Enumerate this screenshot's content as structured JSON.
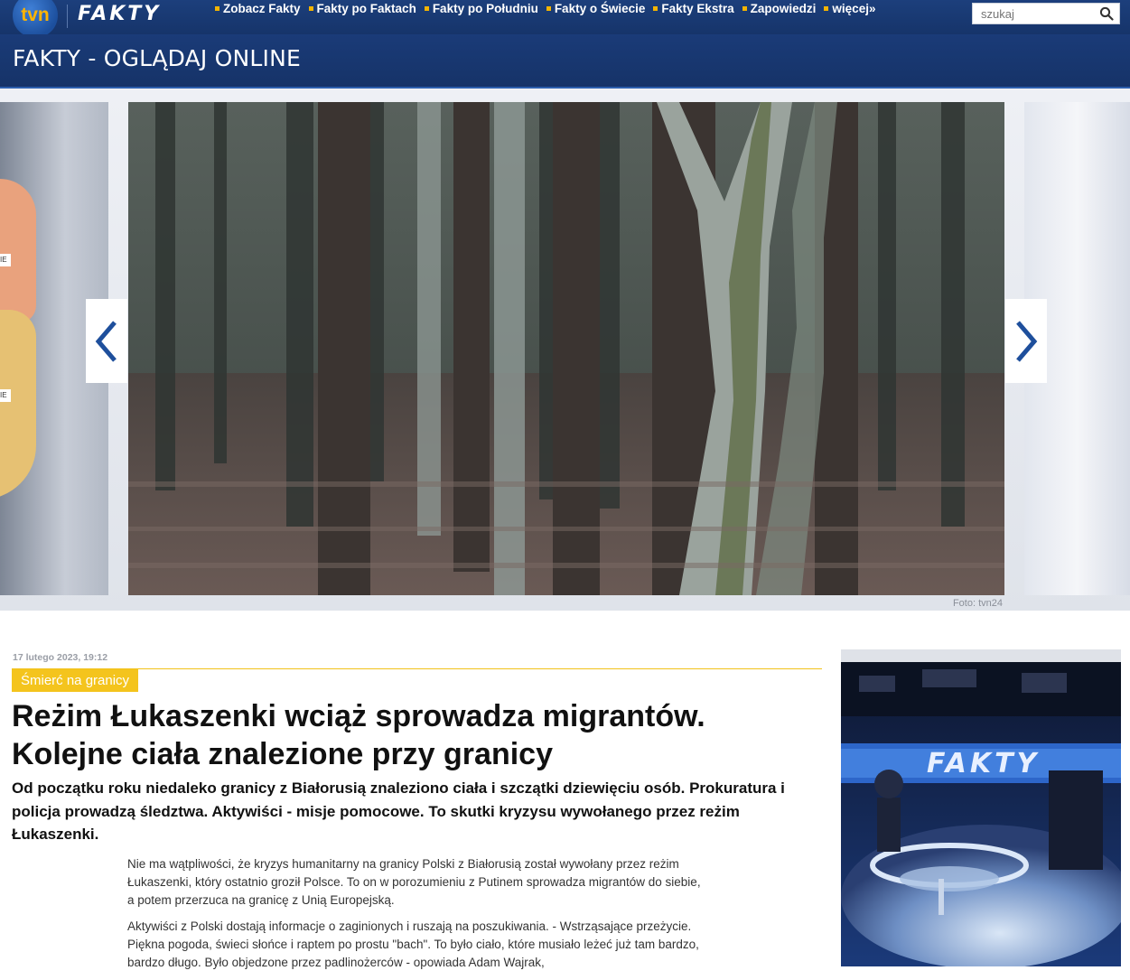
{
  "header": {
    "logo_tvn": "tvn",
    "logo_fakty": "FAKTY",
    "nav": [
      {
        "label": "Zobacz Fakty"
      },
      {
        "label": "Fakty po Faktach"
      },
      {
        "label": "Fakty po Południu"
      },
      {
        "label": "Fakty o Świecie"
      },
      {
        "label": "Fakty Ekstra"
      },
      {
        "label": "Zapowiedzi"
      },
      {
        "label": "więcej»"
      }
    ],
    "search_placeholder": "szukaj",
    "search_icon": "search-icon"
  },
  "page_title": "FAKTY - OGLĄDAJ ONLINE",
  "gallery": {
    "caption": "Foto: tvn24",
    "prev_icon": "chevron-left-icon",
    "next_icon": "chevron-right-icon",
    "left_tags": [
      "IE",
      "IE"
    ],
    "accent_color": "#1e4f9c"
  },
  "article": {
    "date": "17 lutego 2023, 19:12",
    "category": "Śmierć na granicy",
    "title": "Reżim Łukaszenki wciąż sprowadza migrantów. Kolejne ciała znalezione przy granicy",
    "lead": "Od początku roku niedaleko granicy z Białorusią znaleziono ciała i szczątki dziewięciu osób. Prokuratura i policja prowadzą śledztwa. Aktywiści - misje pomocowe. To skutki kryzysu wywołanego przez reżim Łukaszenki.",
    "paragraphs": [
      "Nie ma wątpliwości, że kryzys humanitarny na granicy Polski z Białorusią został wywołany przez reżim Łukaszenki, który ostatnio groził Polsce. To on w porozumieniu z Putinem sprowadza migrantów do siebie, a potem przerzuca na granicę z Unią Europejską.",
      "Aktywiści z Polski dostają informacje o zaginionych i ruszają na poszukiwania. - Wstrząsające przeżycie. Piękna pogoda, świeci słońce i raptem po prostu \"bach\". To było ciało, które musiało leżeć już tam bardzo, bardzo długo. Było objedzone przez padlinożerców - opowiada Adam Wajrak,"
    ],
    "accent_color": "#f4c41d"
  },
  "sidebar": {
    "studio_logo": "FAKTY"
  }
}
